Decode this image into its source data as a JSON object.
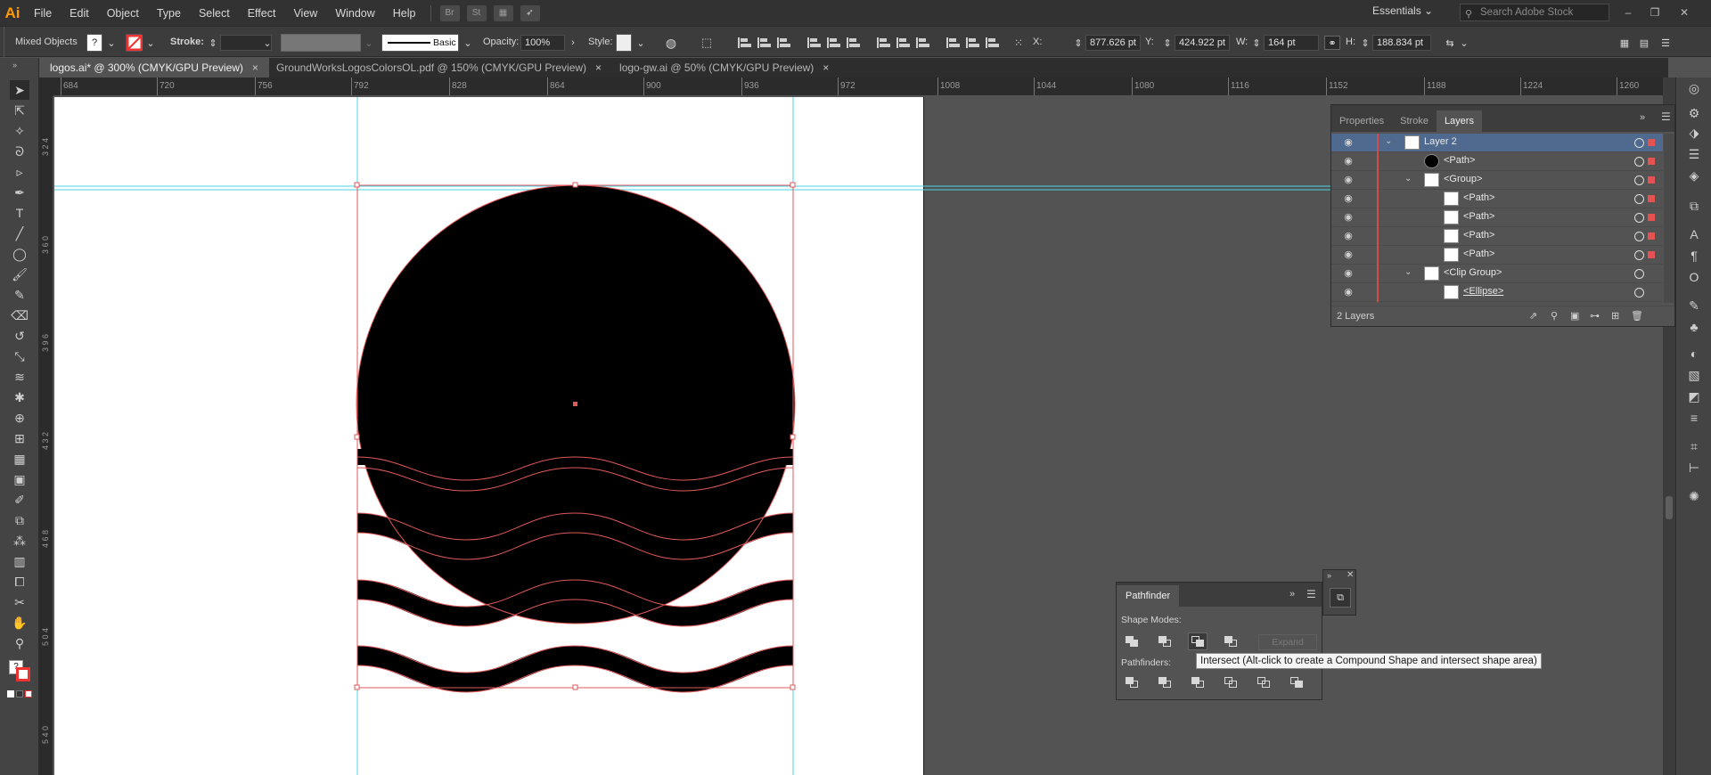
{
  "app": {
    "logo": "Ai"
  },
  "menu": [
    "File",
    "Edit",
    "Object",
    "Type",
    "Select",
    "Effect",
    "View",
    "Window",
    "Help"
  ],
  "menubar_buttons": [
    "Br",
    "St"
  ],
  "workspace": "Essentials",
  "stock_search": {
    "placeholder": "Search Adobe Stock"
  },
  "control": {
    "selection_label": "Mixed Objects",
    "fill_value": "?",
    "stroke_label": "Stroke:",
    "brush_label": "Basic",
    "opacity_label": "Opacity:",
    "opacity_value": "100%",
    "style_label": "Style:",
    "x_label": "X:",
    "x_value": "877.626 pt",
    "y_label": "Y:",
    "y_value": "424.922 pt",
    "w_label": "W:",
    "w_value": "164 pt",
    "h_label": "H:",
    "h_value": "188.834 pt"
  },
  "tabs": [
    {
      "label": "logos.ai* @ 300% (CMYK/GPU Preview)",
      "close": "×",
      "active": true
    },
    {
      "label": "GroundWorksLogosColorsOL.pdf @ 150% (CMYK/GPU Preview)",
      "close": "×",
      "active": false
    },
    {
      "label": "logo-gw.ai @ 50% (CMYK/GPU Preview)",
      "close": "×",
      "active": false
    }
  ],
  "hruler_ticks": [
    "684",
    "720",
    "756",
    "792",
    "828",
    "864",
    "900",
    "936",
    "972",
    "1008",
    "1044",
    "1080",
    "1116",
    "1152",
    "1188",
    "1224",
    "1260"
  ],
  "vruler_ticks": [
    "3 2 4",
    "3 6 0",
    "3 9 6",
    "4 3 2",
    "4 6 8",
    "5 0 4",
    "5 4 0"
  ],
  "layers_panel": {
    "tabs": [
      "Properties",
      "Stroke",
      "Layers"
    ],
    "active_tab": "Layers",
    "rows": [
      {
        "name": "Layer 2",
        "indent": 0,
        "caret": "⌄",
        "selected": true
      },
      {
        "name": "<Path>",
        "indent": 1,
        "caret": "",
        "selected": false
      },
      {
        "name": "<Group>",
        "indent": 1,
        "caret": "⌄",
        "selected": false
      },
      {
        "name": "<Path>",
        "indent": 2,
        "caret": "",
        "selected": false
      },
      {
        "name": "<Path>",
        "indent": 2,
        "caret": "",
        "selected": false
      },
      {
        "name": "<Path>",
        "indent": 2,
        "caret": "",
        "selected": false
      },
      {
        "name": "<Path>",
        "indent": 2,
        "caret": "",
        "selected": false
      },
      {
        "name": "<Clip Group>",
        "indent": 1,
        "caret": "⌄",
        "selected": false
      },
      {
        "name": "<Ellipse>",
        "indent": 2,
        "caret": "",
        "selected": false
      }
    ],
    "footer_count": "2 Layers"
  },
  "pathfinder": {
    "title": "Pathfinder",
    "shape_modes_label": "Shape Modes:",
    "pathfinders_label": "Pathfinders:",
    "expand_label": "Expand",
    "tooltip": "Intersect (Alt-click to create a Compound Shape and intersect shape area)"
  },
  "colors": {
    "guide": "#49d6e6",
    "selection": "#e05a5a",
    "artboard": "#ffffff",
    "layer_selected": "#4f6a8e"
  }
}
